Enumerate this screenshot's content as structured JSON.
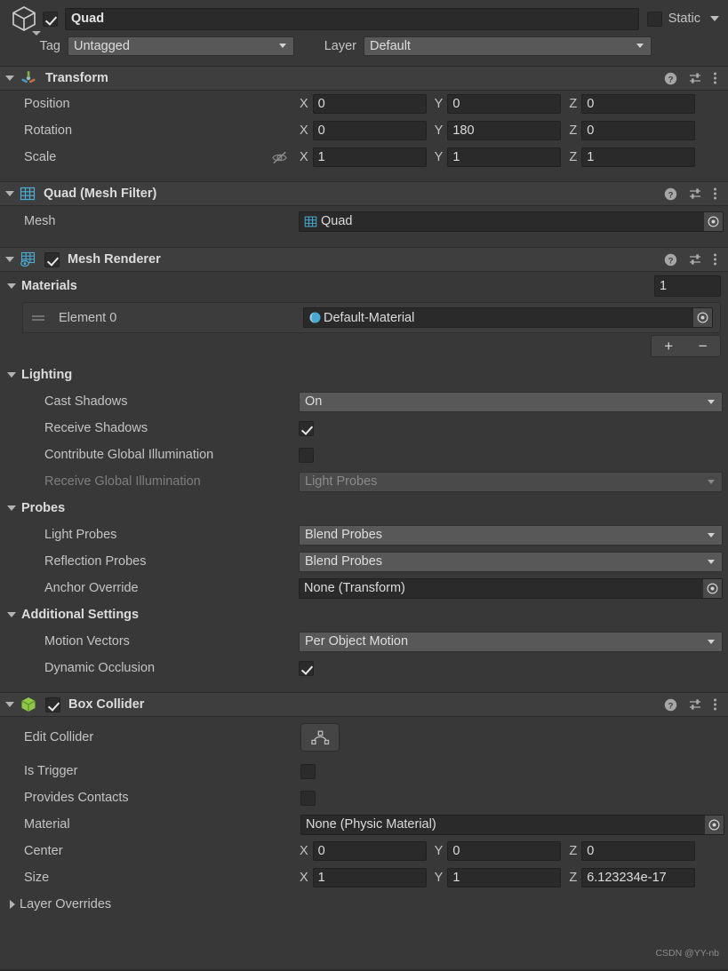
{
  "gameobject": {
    "icon": "cube-icon",
    "enabled": true,
    "name": "Quad",
    "static_label": "Static",
    "static_checked": false,
    "tag_label": "Tag",
    "tag_value": "Untagged",
    "layer_label": "Layer",
    "layer_value": "Default"
  },
  "components": [
    {
      "id": "transform",
      "title": "Transform",
      "icon": "transform-axis-icon",
      "has_enable_checkbox": false,
      "expanded": true,
      "rows": [
        {
          "type": "vector3",
          "label": "Position",
          "x": "0",
          "y": "0",
          "z": "0"
        },
        {
          "type": "vector3",
          "label": "Rotation",
          "x": "0",
          "y": "180",
          "z": "0"
        },
        {
          "type": "vector3",
          "label": "Scale",
          "x": "1",
          "y": "1",
          "z": "1",
          "lock_icon": "constrain-proportions-off-icon"
        }
      ]
    },
    {
      "id": "mesh-filter",
      "title": "Quad (Mesh Filter)",
      "icon": "mesh-filter-icon",
      "has_enable_checkbox": false,
      "expanded": true,
      "rows": [
        {
          "type": "object",
          "label": "Mesh",
          "value": "Quad",
          "value_icon": "mesh-icon"
        }
      ]
    },
    {
      "id": "mesh-renderer",
      "title": "Mesh Renderer",
      "icon": "mesh-renderer-icon",
      "has_enable_checkbox": true,
      "enabled": true,
      "expanded": true
    },
    {
      "id": "box-collider",
      "title": "Box Collider",
      "icon": "box-collider-icon",
      "has_enable_checkbox": true,
      "enabled": true,
      "expanded": true
    }
  ],
  "mesh_renderer": {
    "materials": {
      "section_label": "Materials",
      "size_value": "1",
      "element_label": "Element 0",
      "element_value": "Default-Material",
      "element_icon": "material-sphere-icon",
      "add_button": "+",
      "remove_button": "−"
    },
    "lighting": {
      "section_label": "Lighting",
      "cast_shadows_label": "Cast Shadows",
      "cast_shadows_value": "On",
      "receive_shadows_label": "Receive Shadows",
      "receive_shadows_checked": true,
      "contribute_gi_label": "Contribute Global Illumination",
      "contribute_gi_checked": false,
      "receive_gi_label": "Receive Global Illumination",
      "receive_gi_value": "Light Probes",
      "receive_gi_disabled": true
    },
    "probes": {
      "section_label": "Probes",
      "light_probes_label": "Light Probes",
      "light_probes_value": "Blend Probes",
      "reflection_probes_label": "Reflection Probes",
      "reflection_probes_value": "Blend Probes",
      "anchor_override_label": "Anchor Override",
      "anchor_override_value": "None (Transform)"
    },
    "additional": {
      "section_label": "Additional Settings",
      "motion_vectors_label": "Motion Vectors",
      "motion_vectors_value": "Per Object Motion",
      "dynamic_occlusion_label": "Dynamic Occlusion",
      "dynamic_occlusion_checked": true
    }
  },
  "box_collider": {
    "edit_collider_label": "Edit Collider",
    "edit_collider_icon": "edit-collider-icon",
    "is_trigger_label": "Is Trigger",
    "is_trigger_checked": false,
    "provides_contacts_label": "Provides Contacts",
    "provides_contacts_checked": false,
    "material_label": "Material",
    "material_value": "None (Physic Material)",
    "center_label": "Center",
    "center": {
      "x": "0",
      "y": "0",
      "z": "0"
    },
    "size_label": "Size",
    "size": {
      "x": "1",
      "y": "1",
      "z": "6.123234e-17"
    },
    "layer_overrides_label": "Layer Overrides",
    "layer_overrides_expanded": false
  },
  "watermark": "CSDN @YY-nb",
  "colors": {
    "background": "#383838",
    "header_bar": "#3e3e3e",
    "field_bg": "#2a2a2a",
    "dropdown_bg": "#585858",
    "accent_blue": "#4ec0f0",
    "accent_green": "#92d050",
    "text": "#c9c9c9"
  }
}
